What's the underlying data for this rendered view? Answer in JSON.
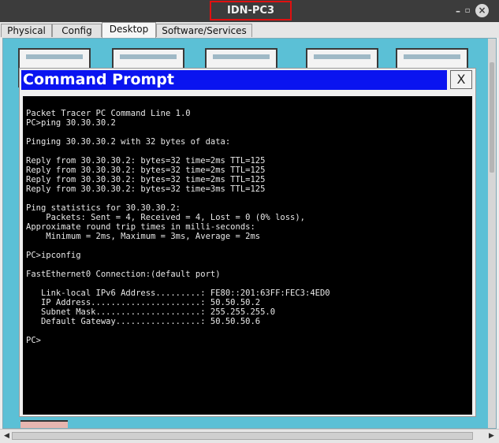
{
  "window": {
    "title": "IDN-PC3"
  },
  "tabs": [
    {
      "label": "Physical"
    },
    {
      "label": "Config"
    },
    {
      "label": "Desktop"
    },
    {
      "label": "Software/Services"
    }
  ],
  "cmd": {
    "title": "Command Prompt",
    "close_label": "X",
    "lines": [
      "Packet Tracer PC Command Line 1.0",
      "PC>ping 30.30.30.2",
      "",
      "Pinging 30.30.30.2 with 32 bytes of data:",
      "",
      "Reply from 30.30.30.2: bytes=32 time=2ms TTL=125",
      "Reply from 30.30.30.2: bytes=32 time=2ms TTL=125",
      "Reply from 30.30.30.2: bytes=32 time=2ms TTL=125",
      "Reply from 30.30.30.2: bytes=32 time=3ms TTL=125",
      "",
      "Ping statistics for 30.30.30.2:",
      "    Packets: Sent = 4, Received = 4, Lost = 0 (0% loss),",
      "Approximate round trip times in milli-seconds:",
      "    Minimum = 2ms, Maximum = 3ms, Average = 2ms",
      "",
      "PC>ipconfig",
      "",
      "FastEthernet0 Connection:(default port)",
      "",
      "   Link-local IPv6 Address.........: FE80::201:63FF:FEC3:4ED0",
      "   IP Address......................: 50.50.50.2",
      "   Subnet Mask.....................: 255.255.255.0",
      "   Default Gateway.................: 50.50.50.6",
      "",
      "PC>"
    ]
  }
}
